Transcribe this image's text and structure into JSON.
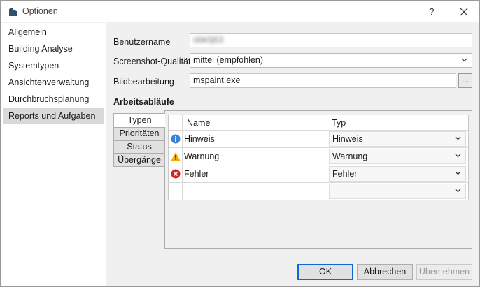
{
  "window": {
    "title": "Optionen",
    "help_label": "?"
  },
  "nav": {
    "items": [
      {
        "label": "Allgemein"
      },
      {
        "label": "Building Analyse"
      },
      {
        "label": "Systemtypen"
      },
      {
        "label": "Ansichtenverwaltung"
      },
      {
        "label": "Durchbruchsplanung"
      },
      {
        "label": "Reports und Aufgaben",
        "selected": true
      }
    ]
  },
  "form": {
    "username_label": "Benutzername",
    "username_value": "sbk0j63",
    "quality_label": "Screenshot-Qualität",
    "quality_value": "mittel (empfohlen)",
    "editor_label": "Bildbearbeitung",
    "editor_value": "mspaint.exe",
    "browse_label": "..."
  },
  "workflows": {
    "title": "Arbeitsabläufe",
    "tabs": [
      "Typen",
      "Prioritäten",
      "Status",
      "Übergänge"
    ],
    "active_tab": "Typen",
    "columns": [
      "Name",
      "Typ"
    ],
    "rows": [
      {
        "icon": "info-icon",
        "name": "Hinweis",
        "type": "Hinweis"
      },
      {
        "icon": "warning-icon",
        "name": "Warnung",
        "type": "Warnung"
      },
      {
        "icon": "error-icon",
        "name": "Fehler",
        "type": "Fehler"
      },
      {
        "icon": "",
        "name": "",
        "type": ""
      }
    ]
  },
  "buttons": {
    "ok": "OK",
    "cancel": "Abbrechen",
    "apply": "Übernehmen"
  },
  "colors": {
    "accent": "#0a6bd8",
    "info": "#3b82d6",
    "warning": "#f2a900",
    "error": "#d42222"
  }
}
